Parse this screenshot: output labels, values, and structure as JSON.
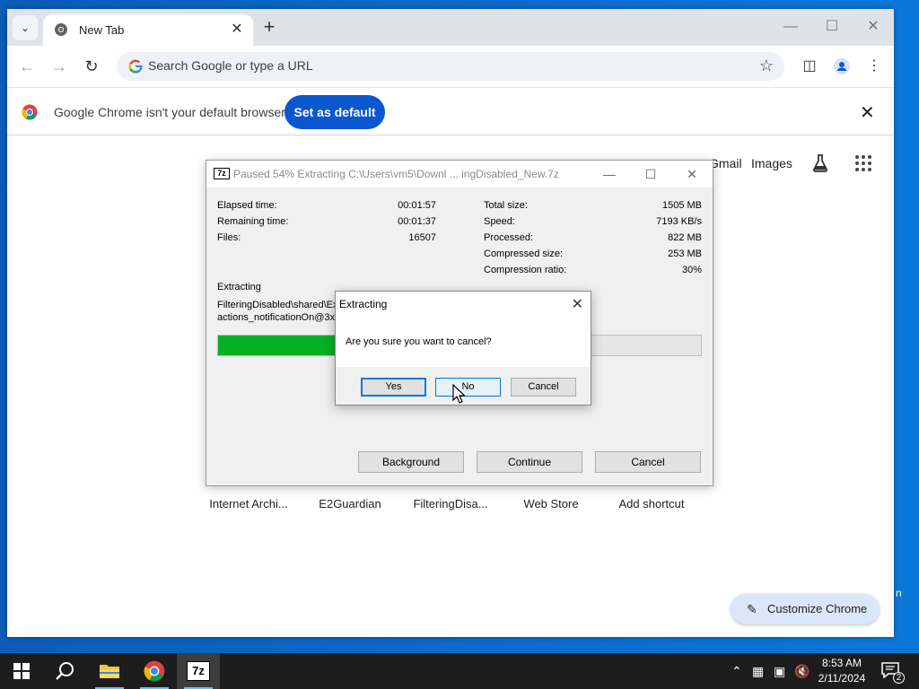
{
  "browser": {
    "tab": {
      "title": "New Tab"
    },
    "omnibox": {
      "placeholder": "Search Google or type a URL"
    },
    "infobar": {
      "message": "Google Chrome isn't your default browser",
      "button": "Set as default"
    },
    "ntp": {
      "links": [
        "Gmail",
        "Images"
      ],
      "shortcuts": [
        "Internet Archi...",
        "E2Guardian",
        "FilteringDisa...",
        "Web Store",
        "Add shortcut"
      ],
      "customize": "Customize Chrome"
    }
  },
  "zip_progress": {
    "logo": "7z",
    "title": "Paused 54% Extracting C:\\Users\\vm5\\Downl ... ingDisabled_New.7z",
    "left_stats": [
      {
        "label": "Elapsed time:",
        "value": "00:01:57"
      },
      {
        "label": "Remaining time:",
        "value": "00:01:37"
      },
      {
        "label": "Files:",
        "value": "16507"
      }
    ],
    "right_stats": [
      {
        "label": "Total size:",
        "value": "1505 MB"
      },
      {
        "label": "Speed:",
        "value": "7193 KB/s"
      },
      {
        "label": "Processed:",
        "value": "822 MB"
      },
      {
        "label": "Compressed size:",
        "value": "253 MB"
      },
      {
        "label": "Compression ratio:",
        "value": "30%"
      }
    ],
    "status": "Extracting",
    "file_line1": "FilteringDisabled\\shared\\Ex",
    "file_line2": "actions_notificationOn@3x.p",
    "progress_percent": 54,
    "buttons": {
      "background": "Background",
      "continue": "Continue",
      "cancel": "Cancel"
    }
  },
  "confirm": {
    "title": "Extracting",
    "message": "Are you sure you want to cancel?",
    "buttons": {
      "yes": "Yes",
      "no": "No",
      "cancel": "Cancel"
    }
  },
  "taskbar": {
    "apps": [
      "file-explorer",
      "google-chrome",
      "7-zip"
    ],
    "clock": {
      "time": "8:53 AM",
      "date": "2/11/2024"
    },
    "notifications": "2"
  },
  "colors": {
    "progress": "#06b025",
    "accent": "#0b57d0",
    "desktop": "#0a63c4",
    "taskbar": "#1d1d1d"
  }
}
